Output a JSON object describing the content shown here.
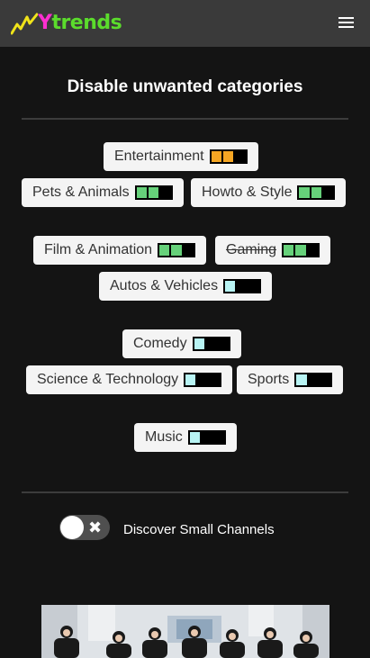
{
  "header": {
    "logo_y": "Y",
    "logo_rest": "trends",
    "logo_icon": "trend-zigzag-icon",
    "menu_icon": "hamburger-menu-icon"
  },
  "page": {
    "title": "Disable unwanted categories"
  },
  "colors": {
    "background": "#141414",
    "topbar": "#3a3a3a",
    "chip": "#f4f4f4",
    "high": "#f5a623",
    "medium": "#66d17a",
    "low": "#b8f4f4",
    "empty": "#000000",
    "logo_magenta": "#ff2fd0",
    "logo_green": "#5bdc2c"
  },
  "categories": [
    {
      "label": "Entertainment",
      "level": 2,
      "color": "high",
      "disabled": false
    },
    {
      "label": "Pets & Animals",
      "level": 2,
      "color": "medium",
      "disabled": false
    },
    {
      "label": "Howto & Style",
      "level": 2,
      "color": "medium",
      "disabled": false
    },
    {
      "label": "Film & Animation",
      "level": 2,
      "color": "medium",
      "disabled": false
    },
    {
      "label": "Gaming",
      "level": 2,
      "color": "medium",
      "disabled": true
    },
    {
      "label": "Autos & Vehicles",
      "level": 1,
      "color": "low",
      "disabled": false
    },
    {
      "label": "Comedy",
      "level": 1,
      "color": "low",
      "disabled": false
    },
    {
      "label": "Science & Technology",
      "level": 1,
      "color": "low",
      "disabled": false
    },
    {
      "label": "Sports",
      "level": 1,
      "color": "low",
      "disabled": false
    },
    {
      "label": "Music",
      "level": 1,
      "color": "low",
      "disabled": false
    }
  ],
  "discover_small": {
    "label": "Discover Small Channels",
    "enabled": false,
    "icon": "close-icon"
  }
}
